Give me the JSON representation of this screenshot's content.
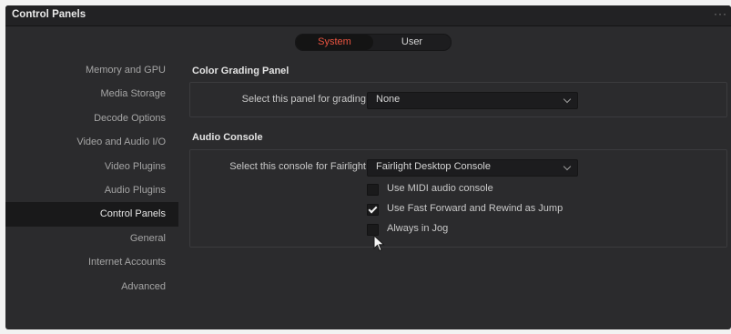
{
  "window": {
    "title": "Control Panels"
  },
  "segmented": {
    "options": [
      "System",
      "User"
    ],
    "selected": "System"
  },
  "sidebar": {
    "items": [
      {
        "label": "Memory and GPU"
      },
      {
        "label": "Media Storage"
      },
      {
        "label": "Decode Options"
      },
      {
        "label": "Video and Audio I/O"
      },
      {
        "label": "Video Plugins"
      },
      {
        "label": "Audio Plugins"
      },
      {
        "label": "Control Panels"
      },
      {
        "label": "General"
      },
      {
        "label": "Internet Accounts"
      },
      {
        "label": "Advanced"
      }
    ],
    "active": "Control Panels"
  },
  "color_grading": {
    "title": "Color Grading Panel",
    "label": "Select this panel for grading",
    "value": "None"
  },
  "audio_console": {
    "title": "Audio Console",
    "label": "Select this console for Fairlight",
    "value": "Fairlight Desktop Console",
    "checkboxes": [
      {
        "label": "Use MIDI audio console",
        "checked": false
      },
      {
        "label": "Use Fast Forward and Rewind as Jump",
        "checked": true
      },
      {
        "label": "Always in Jog",
        "checked": false
      }
    ]
  },
  "colors": {
    "accent": "#ea5440",
    "background": "#2b2b2d",
    "active_row": "#19191a"
  }
}
